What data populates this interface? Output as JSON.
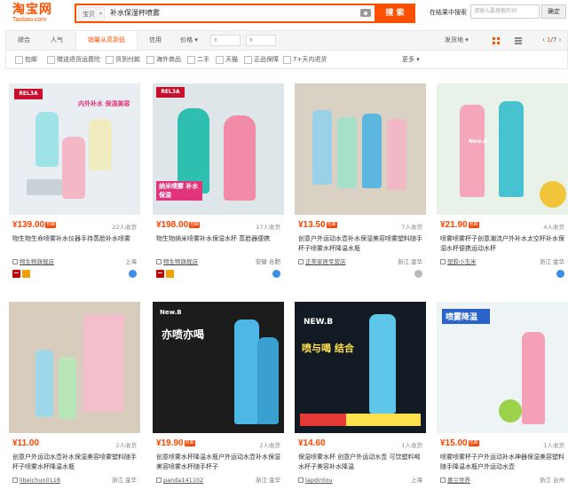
{
  "header": {
    "logo_main": "淘宝网",
    "logo_sub": "Taobao.com",
    "search_category": "宝贝",
    "search_query": "补水保湿杯喷雾",
    "search_button": "搜 索",
    "in_results_label": "在结果中搜索",
    "in_results_placeholder": "请输入要搜索的词",
    "in_results_button": "确定"
  },
  "sort": {
    "tabs": [
      "综合",
      "人气",
      "销量从高到低",
      "信用",
      "价格 ▾"
    ],
    "active_tab": "销量从高到低",
    "price_from_placeholder": "¥",
    "price_to_placeholder": "¥",
    "ship_from": "发货地 ▾",
    "page_current": "1",
    "page_total": "/7",
    "prev": "‹",
    "next": "›"
  },
  "filters": {
    "items": [
      "包邮",
      "赠送退货运费险",
      "货到付款",
      "海外商品",
      "二手",
      "天猫",
      "正品保障",
      "7+天内退货"
    ],
    "more": "更多 ▾"
  },
  "products": [
    {
      "price": "¥139.00",
      "badge": "包邮",
      "sales": "22人收货",
      "title_pre": "物生物生命喷雾补水仪器手持蒸脸补水喷雾",
      "title_hl": "",
      "shop": "物生物旗舰店",
      "location": "上海",
      "tmall": true,
      "ww_active": true,
      "img_text": "内外补水 保湿美容"
    },
    {
      "price": "¥198.00",
      "badge": "包邮",
      "sales": "17人收货",
      "title_pre": "物生物纳米喷雾补水保湿水杯 蒸脸器便携",
      "title_hl": "",
      "shop": "物生物旗舰店",
      "location": "安徽 合肥",
      "tmall": true,
      "ww_active": true,
      "img_text": "纳米喷雾 补水保湿"
    },
    {
      "price": "¥13.50",
      "badge": "包邮",
      "sales": "7人收货",
      "title_pre": "创意户外运动水壶补水保湿美容喷雾塑料随手杯子喷雾水杯降温水瓶",
      "title_hl": "",
      "shop": "正美家居专营店",
      "location": "浙江 金华",
      "tmall": false,
      "ww_active": false,
      "img_text": ""
    },
    {
      "price": "¥21.90",
      "badge": "包邮",
      "sales": "4人收货",
      "title_pre": "喷雾喷雾杯子创意潮流户外补水太空杯补水保湿水杯便携运动水杯",
      "title_hl": "",
      "shop": "塑胶小玉米",
      "location": "浙江 金华",
      "tmall": false,
      "ww_active": true,
      "img_text": "New.B"
    },
    {
      "price": "¥11.00",
      "badge": "",
      "sales": "2人收货",
      "title_pre": "创意户外运动水壶补水保湿美容喷雾塑料随手杯子喷雾水杯降温水瓶",
      "title_hl": "",
      "shop": "libeichun0118",
      "location": "浙江 金华",
      "tmall": false,
      "ww_active": true,
      "img_text": ""
    },
    {
      "price": "¥19.90",
      "badge": "包邮",
      "sales": "2人收货",
      "title_pre": "创意喷雾水杯降温水瓶户外运动水壶补水保湿美容喷雾水杯随手杯子",
      "title_hl": "",
      "shop": "panda141102",
      "location": "浙江 金华",
      "tmall": false,
      "ww_active": true,
      "img_text": "亦喷亦喝"
    },
    {
      "price": "¥14.60",
      "badge": "",
      "sales": "1人收货",
      "title_pre": "保湿喷雾水杯 创意户外运动水壶 可饮塑料喝水杯子美容补水降温",
      "title_hl": "",
      "shop": "lapdintou",
      "location": "上海",
      "tmall": false,
      "ww_active": true,
      "img_text": "喷与喝 结合"
    },
    {
      "price": "¥15.00",
      "badge": "包邮",
      "sales": "1人收货",
      "title_pre": "喷雾喷雾杯子户外运动补水神器保湿美容塑料随手降温水瓶户外运动水壶",
      "title_hl": "",
      "shop": "喜兰世界",
      "location": "浙江 台州",
      "tmall": false,
      "ww_active": true,
      "img_text": "喷雾降温"
    }
  ],
  "colors": {
    "accent": "#ff5000",
    "price": "#ff4400"
  }
}
